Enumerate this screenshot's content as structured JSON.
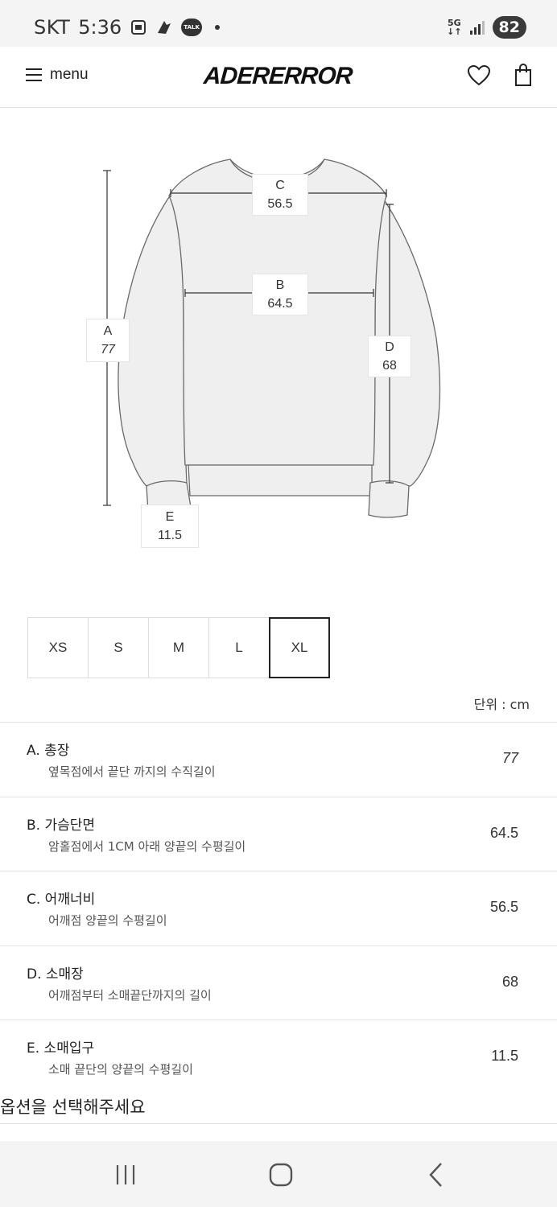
{
  "status_bar": {
    "carrier": "SKT",
    "time": "5:36",
    "talk_badge": "TALK",
    "network": "5G",
    "battery": "82"
  },
  "header": {
    "menu_label": "menu",
    "brand": "ADERERROR"
  },
  "diagram": {
    "labels": {
      "A": {
        "letter": "A",
        "value": "77"
      },
      "B": {
        "letter": "B",
        "value": "64.5"
      },
      "C": {
        "letter": "C",
        "value": "56.5"
      },
      "D": {
        "letter": "D",
        "value": "68"
      },
      "E": {
        "letter": "E",
        "value": "11.5"
      }
    }
  },
  "sizes": {
    "options": [
      "XS",
      "S",
      "M",
      "L",
      "XL"
    ],
    "selected": "XL"
  },
  "unit_label": "단위 : cm",
  "measurements": [
    {
      "title": "A.  총장",
      "desc": "옆목점에서 끝단 까지의 수직길이",
      "value": "77"
    },
    {
      "title": "B.  가슴단면",
      "desc": "암홀점에서 1CM 아래 양끝의 수평길이",
      "value": "64.5"
    },
    {
      "title": "C.  어깨너비",
      "desc": "어깨점 양끝의 수평길이",
      "value": "56.5"
    },
    {
      "title": "D.  소매장",
      "desc": "어깨점부터 소매끝단까지의 길이",
      "value": "68"
    },
    {
      "title": "E.  소매입구",
      "desc": "소매 끝단의 양끝의 수평길이",
      "value": "11.5"
    }
  ],
  "option_prompt": "옵션을 선택해주세요"
}
